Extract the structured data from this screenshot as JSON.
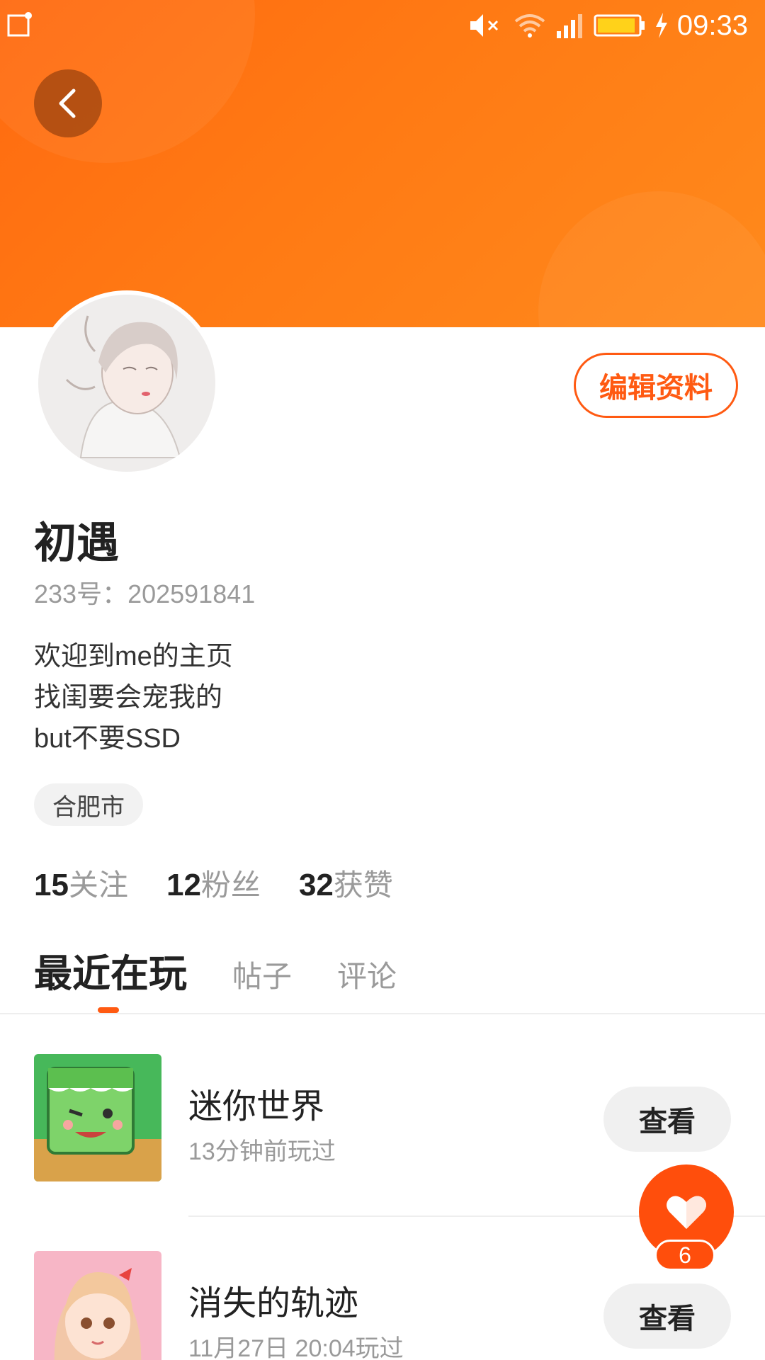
{
  "status_bar": {
    "time": "09:33",
    "icons": [
      "notification-icon",
      "mute-icon",
      "wifi-icon",
      "signal-icon",
      "battery-icon",
      "charging-icon"
    ]
  },
  "header": {
    "back_icon": "chevron-left-icon"
  },
  "profile": {
    "edit_label": "编辑资料",
    "name": "初遇",
    "uid": "233号：202591841",
    "bio": [
      "欢迎到me的主页",
      "找闺要会宠我的",
      "but不要SSD"
    ],
    "location": "合肥市",
    "stats": [
      {
        "value": "15",
        "label": "关注"
      },
      {
        "value": "12",
        "label": "粉丝"
      },
      {
        "value": "32",
        "label": "获赞"
      }
    ]
  },
  "tabs": [
    {
      "label": "最近在玩",
      "active": true
    },
    {
      "label": "帖子",
      "active": false
    },
    {
      "label": "评论",
      "active": false
    }
  ],
  "games": [
    {
      "title": "迷你世界",
      "subtitle": "13分钟前玩过",
      "button": "查看"
    },
    {
      "title": "消失的轨迹",
      "subtitle": "11月27日 20:04玩过",
      "button": "查看"
    }
  ],
  "like": {
    "icon": "heart-icon",
    "count": "6"
  },
  "colors": {
    "accent": "#ff5a12",
    "banner_start": "#ff6a10",
    "banner_end": "#ff8a1c"
  }
}
